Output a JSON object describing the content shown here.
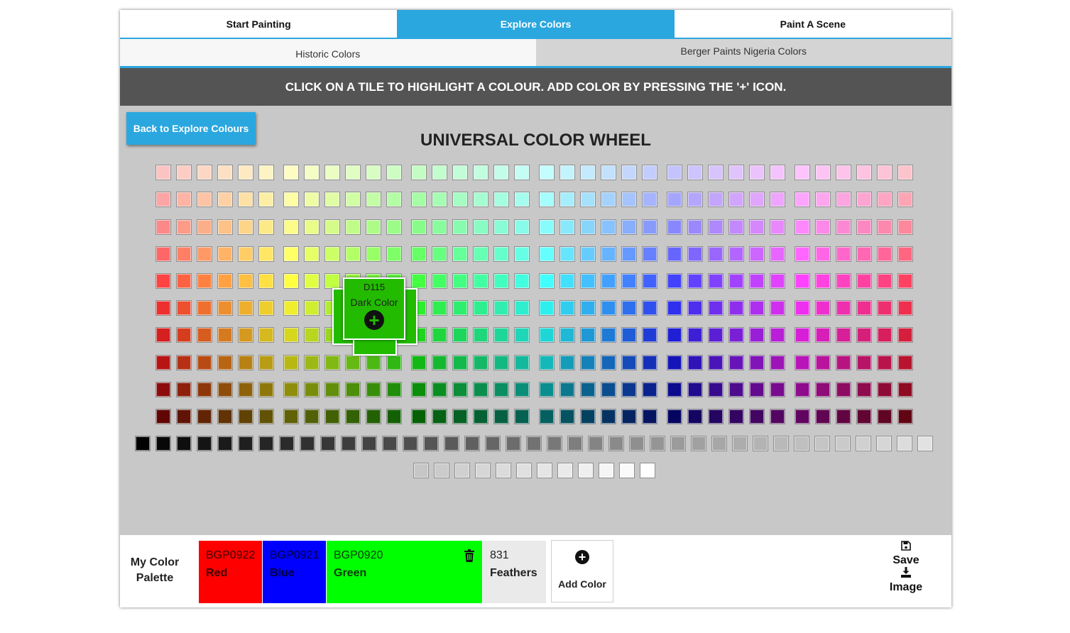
{
  "main_tabs": [
    {
      "label": "Start Painting",
      "active": false
    },
    {
      "label": "Explore Colors",
      "active": true
    },
    {
      "label": "Paint A Scene",
      "active": false
    }
  ],
  "sub_tabs": [
    {
      "label": "Historic Colors",
      "active": true
    },
    {
      "label": "Berger Paints Nigeria Colors",
      "active": false
    }
  ],
  "instruction_banner": "CLICK ON A TILE TO HIGHLIGHT A COLOUR. ADD COLOR BY PRESSING THE '+' ICON.",
  "back_button": "Back to Explore Colours",
  "wheel_title": "UNIVERSAL COLOR WHEEL",
  "color_wheel": {
    "hue_columns": 36,
    "rows": 10,
    "highlighted": {
      "code": "D115",
      "name": "Dark Color",
      "color": "#22bb00",
      "add_icon": "plus-circle-icon"
    }
  },
  "grayscale_row_count": 39,
  "light_gray_row_count": 12,
  "palette": {
    "label": "My Color Palette",
    "chips": [
      {
        "code": "BGP0922",
        "name": "Red",
        "color": "#ff0000"
      },
      {
        "code": "BGP0921",
        "name": "Blue",
        "color": "#0000ff"
      },
      {
        "code": "BGP0920",
        "name": "Green",
        "color": "#00ff00",
        "icon": "trash-icon"
      },
      {
        "code": "831",
        "name": "Feathers",
        "color": "#eaeaea"
      }
    ],
    "add_color_label": "Add Color",
    "add_color_icon": "plus-circle-icon"
  },
  "save_image": {
    "line1": "Save",
    "line2": "Image",
    "icons": [
      "save-icon",
      "download-icon"
    ]
  }
}
